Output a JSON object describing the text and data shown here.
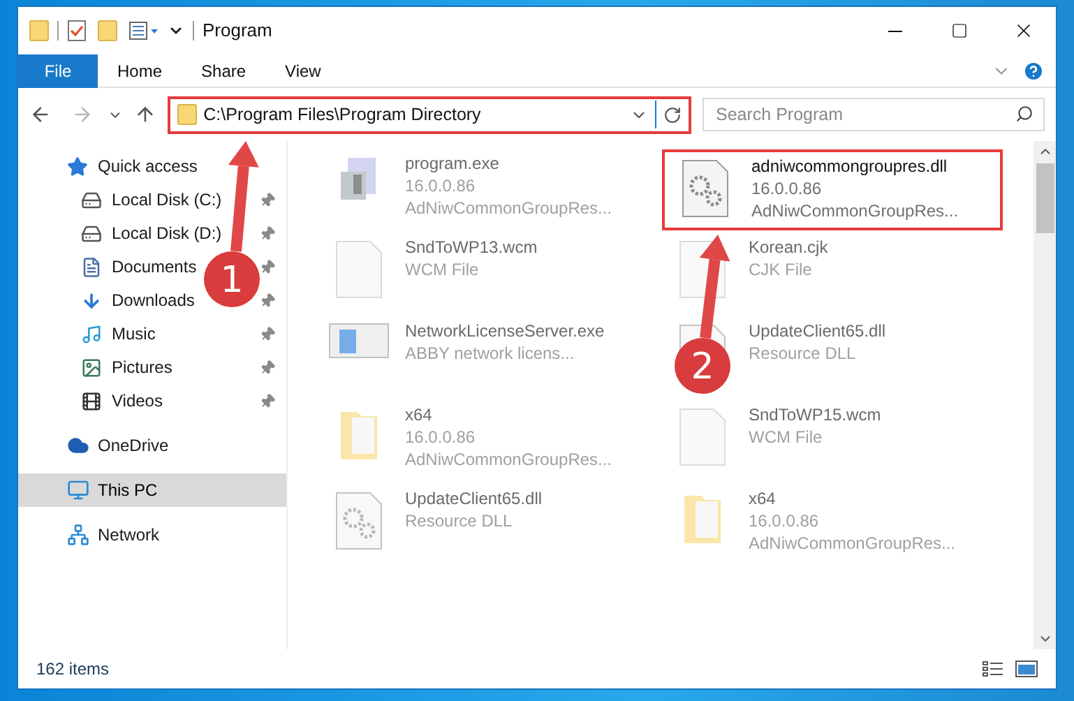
{
  "window": {
    "title": "Program"
  },
  "ribbon_tabs": [
    {
      "label": "File",
      "kind": "file"
    },
    {
      "label": "Home",
      "kind": "tab"
    },
    {
      "label": "Share",
      "kind": "tab"
    },
    {
      "label": "View",
      "kind": "tab"
    }
  ],
  "address_bar": {
    "path": "C:\\Program Files\\Program Directory",
    "highlighted": true
  },
  "search": {
    "placeholder": "Search Program"
  },
  "sidebar": {
    "items": [
      {
        "label": "Quick access",
        "kind": "quick",
        "selected": false,
        "children": [
          {
            "label": "Local Disk (C:)",
            "kind": "drive-c",
            "pinned": true,
            "selected": false
          },
          {
            "label": "Local Disk (D:)",
            "kind": "drive",
            "pinned": true,
            "selected": false
          },
          {
            "label": "Documents",
            "kind": "documents",
            "pinned": true,
            "selected": false
          },
          {
            "label": "Downloads",
            "kind": "downloads",
            "pinned": true,
            "selected": false
          },
          {
            "label": "Music",
            "kind": "music",
            "pinned": true,
            "selected": false
          },
          {
            "label": "Pictures",
            "kind": "pictures",
            "pinned": true,
            "selected": false
          },
          {
            "label": "Videos",
            "kind": "videos",
            "pinned": true,
            "selected": false
          }
        ]
      },
      {
        "label": "OneDrive",
        "kind": "onedrive",
        "selected": false
      },
      {
        "label": "This PC",
        "kind": "pc",
        "selected": true
      },
      {
        "label": "Network",
        "kind": "network",
        "selected": false
      }
    ]
  },
  "files": [
    {
      "name": "program.exe",
      "details": [
        "16.0.0.86",
        "AdNiwCommonGroupRes..."
      ],
      "kind": "exe",
      "highlighted": false,
      "blurred": true
    },
    {
      "name": "adniwcommongroupres.dll",
      "details": [
        "16.0.0.86",
        "AdNiwCommonGroupRes..."
      ],
      "kind": "dll",
      "highlighted": true,
      "blurred": false
    },
    {
      "name": "SndToWP13.wcm",
      "details": [
        "WCM File"
      ],
      "kind": "blank",
      "highlighted": false,
      "blurred": true
    },
    {
      "name": "Korean.cjk",
      "details": [
        "CJK File"
      ],
      "kind": "blank",
      "highlighted": false,
      "blurred": true
    },
    {
      "name": "NetworkLicenseServer.exe",
      "details": [
        "ABBY network licens..."
      ],
      "kind": "app",
      "highlighted": false,
      "blurred": true
    },
    {
      "name": "UpdateClient65.dll",
      "details": [
        "Resource DLL"
      ],
      "kind": "dll",
      "highlighted": false,
      "blurred": true
    },
    {
      "name": "x64",
      "details": [
        "16.0.0.86",
        "AdNiwCommonGroupRes..."
      ],
      "kind": "folder",
      "highlighted": false,
      "blurred": true
    },
    {
      "name": "SndToWP15.wcm",
      "details": [
        "WCM File"
      ],
      "kind": "blank",
      "highlighted": false,
      "blurred": true
    },
    {
      "name": "UpdateClient65.dll",
      "details": [
        "Resource DLL"
      ],
      "kind": "dll",
      "highlighted": false,
      "blurred": true
    },
    {
      "name": "x64",
      "details": [
        "16.0.0.86",
        "AdNiwCommonGroupRes..."
      ],
      "kind": "folder",
      "highlighted": false,
      "blurred": true
    }
  ],
  "status_bar": {
    "count": "162 items"
  },
  "annotations": [
    {
      "label": "1"
    },
    {
      "label": "2"
    }
  ]
}
